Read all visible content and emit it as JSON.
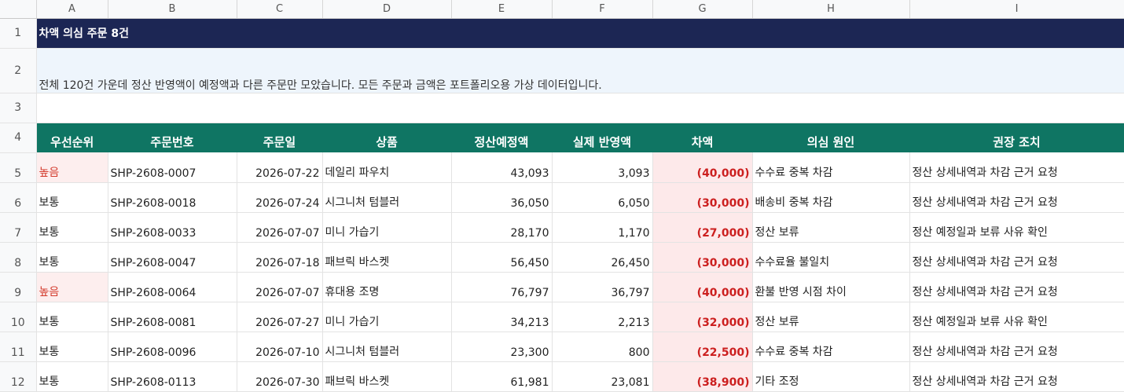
{
  "columns": [
    "A",
    "B",
    "C",
    "D",
    "E",
    "F",
    "G",
    "H",
    "I"
  ],
  "title": "차액 의심 주문 8건",
  "subtitle": "전체 120건 가운데 정산 반영액이 예정액과 다른 주문만 모았습니다. 모든 주문과 금액은 포트폴리오용 가상 데이터입니다.",
  "headers": {
    "priority": "우선순위",
    "order_no": "주문번호",
    "order_date": "주문일",
    "product": "상품",
    "expected": "정산예정액",
    "actual": "실제 반영액",
    "diff": "차액",
    "cause": "의심 원인",
    "action": "권장 조치"
  },
  "rows": [
    {
      "row": "5",
      "priority": "높음",
      "high": true,
      "order_no": "SHP-2608-0007",
      "order_date": "2026-07-22",
      "product": "데일리 파우치",
      "expected": "43,093",
      "actual": "3,093",
      "diff": "(40,000)",
      "cause": "수수료 중복 차감",
      "action": "정산 상세내역과 차감 근거 요청"
    },
    {
      "row": "6",
      "priority": "보통",
      "high": false,
      "order_no": "SHP-2608-0018",
      "order_date": "2026-07-24",
      "product": "시그니처 텀블러",
      "expected": "36,050",
      "actual": "6,050",
      "diff": "(30,000)",
      "cause": "배송비 중복 차감",
      "action": "정산 상세내역과 차감 근거 요청"
    },
    {
      "row": "7",
      "priority": "보통",
      "high": false,
      "order_no": "SHP-2608-0033",
      "order_date": "2026-07-07",
      "product": "미니 가습기",
      "expected": "28,170",
      "actual": "1,170",
      "diff": "(27,000)",
      "cause": "정산 보류",
      "action": "정산 예정일과 보류 사유 확인"
    },
    {
      "row": "8",
      "priority": "보통",
      "high": false,
      "order_no": "SHP-2608-0047",
      "order_date": "2026-07-18",
      "product": "패브릭 바스켓",
      "expected": "56,450",
      "actual": "26,450",
      "diff": "(30,000)",
      "cause": "수수료율 불일치",
      "action": "정산 상세내역과 차감 근거 요청"
    },
    {
      "row": "9",
      "priority": "높음",
      "high": true,
      "order_no": "SHP-2608-0064",
      "order_date": "2026-07-07",
      "product": "휴대용 조명",
      "expected": "76,797",
      "actual": "36,797",
      "diff": "(40,000)",
      "cause": "환불 반영 시점 차이",
      "action": "정산 상세내역과 차감 근거 요청"
    },
    {
      "row": "10",
      "priority": "보통",
      "high": false,
      "order_no": "SHP-2608-0081",
      "order_date": "2026-07-27",
      "product": "미니 가습기",
      "expected": "34,213",
      "actual": "2,213",
      "diff": "(32,000)",
      "cause": "정산 보류",
      "action": "정산 예정일과 보류 사유 확인"
    },
    {
      "row": "11",
      "priority": "보통",
      "high": false,
      "order_no": "SHP-2608-0096",
      "order_date": "2026-07-10",
      "product": "시그니처 텀블러",
      "expected": "23,300",
      "actual": "800",
      "diff": "(22,500)",
      "cause": "수수료 중복 차감",
      "action": "정산 상세내역과 차감 근거 요청"
    },
    {
      "row": "12",
      "priority": "보통",
      "high": false,
      "order_no": "SHP-2608-0113",
      "order_date": "2026-07-30",
      "product": "패브릭 바스켓",
      "expected": "61,981",
      "actual": "23,081",
      "diff": "(38,900)",
      "cause": "기타 조정",
      "action": "정산 상세내역과 차감 근거 요청"
    }
  ],
  "colors": {
    "title_bg": "#1c2654",
    "subtitle_bg": "#eef5fc",
    "header_bg": "#0f7563",
    "negative_text": "#cc1f1f",
    "negative_bg": "#fde9ea",
    "high_priority_text": "#d33a2c"
  }
}
